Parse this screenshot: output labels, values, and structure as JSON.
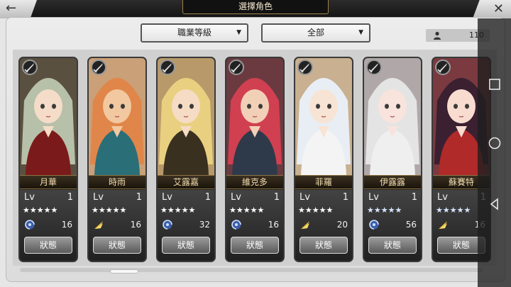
{
  "header": {
    "title": "選擇角色",
    "back_icon": "arrow-left-icon",
    "close_icon": "close-x-icon"
  },
  "filters": {
    "class_select": {
      "value": "職業等級"
    },
    "scope_select": {
      "value": "全部"
    }
  },
  "character_count": "110",
  "status_label": "狀態",
  "level_label": "Lv",
  "characters": [
    {
      "name": "月華",
      "level": "1",
      "stars": "★★★★★",
      "star_style": "white",
      "type_icon": "swirl-icon",
      "power": "16",
      "palette": {
        "hair": "#b7c0a8",
        "skin": "#f4dcc8",
        "cloth": "#7b1a1a",
        "bg": "#5a5040"
      }
    },
    {
      "name": "時雨",
      "level": "1",
      "stars": "★★★★★",
      "star_style": "white",
      "type_icon": "wing-icon",
      "power": "16",
      "palette": {
        "hair": "#e0864a",
        "skin": "#f2c8a0",
        "cloth": "#2a6e78",
        "bg": "#c9a078"
      }
    },
    {
      "name": "艾露嘉",
      "level": "1",
      "stars": "★★★★★",
      "star_style": "white",
      "type_icon": "swirl-icon",
      "power": "32",
      "palette": {
        "hair": "#e8d080",
        "skin": "#f6dcc4",
        "cloth": "#3a3020",
        "bg": "#b89a6a"
      }
    },
    {
      "name": "維克多",
      "level": "1",
      "stars": "★★★★★",
      "star_style": "white",
      "type_icon": "swirl-icon",
      "power": "16",
      "palette": {
        "hair": "#d04050",
        "skin": "#f2d0b8",
        "cloth": "#2e3a4a",
        "bg": "#6a3a40"
      }
    },
    {
      "name": "菲羅",
      "level": "1",
      "stars": "★★★★★",
      "star_style": "white",
      "type_icon": "wing-icon",
      "power": "20",
      "palette": {
        "hair": "#e8eef4",
        "skin": "#f8e4d4",
        "cloth": "#f4f4f4",
        "bg": "#c8b090"
      }
    },
    {
      "name": "伊露露",
      "level": "1",
      "stars": "★★★★★",
      "star_style": "blue",
      "type_icon": "swirl-icon",
      "power": "56",
      "palette": {
        "hair": "#e4e4e4",
        "skin": "#f8e4dc",
        "cloth": "#efefef",
        "bg": "#b0a8a8"
      }
    },
    {
      "name": "蘇賽特",
      "level": "1",
      "stars": "★★★★★",
      "star_style": "blue",
      "type_icon": "wing-icon",
      "power": "16",
      "palette": {
        "hair": "#3a2030",
        "skin": "#f8dcd0",
        "cloth": "#b02a2a",
        "bg": "#7a3a40"
      }
    }
  ]
}
